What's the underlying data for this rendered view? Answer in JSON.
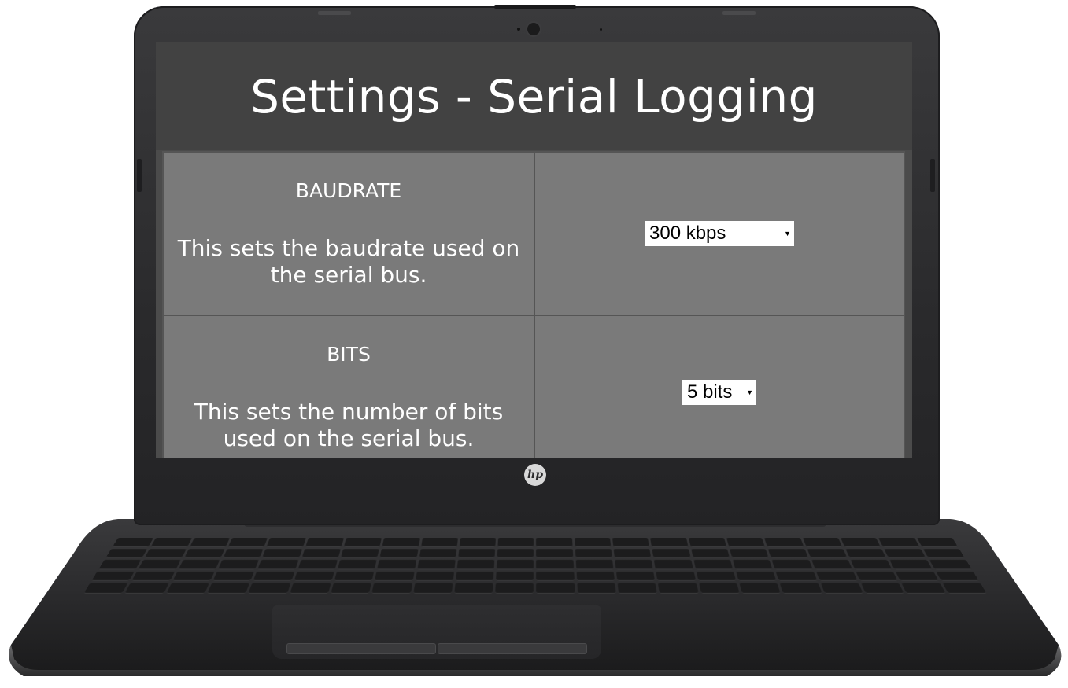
{
  "app": {
    "title": "Settings - Serial Logging"
  },
  "settings": [
    {
      "name": "BAUDRATE",
      "description": "This sets the baudrate used on the serial bus.",
      "selected": "300 kbps"
    },
    {
      "name": "BITS",
      "description": "This sets the number of bits used on the serial bus.",
      "selected": "5 bits"
    }
  ],
  "device": {
    "logo_text": "hp"
  },
  "icons": {
    "dropdown": "dropdown-arrow-icon",
    "camera": "webcam-icon",
    "logo": "hp-logo-icon"
  },
  "colors": {
    "header_bg": "#424242",
    "cell_bg": "#7a7a7a",
    "border": "#555555",
    "text": "#ffffff"
  }
}
